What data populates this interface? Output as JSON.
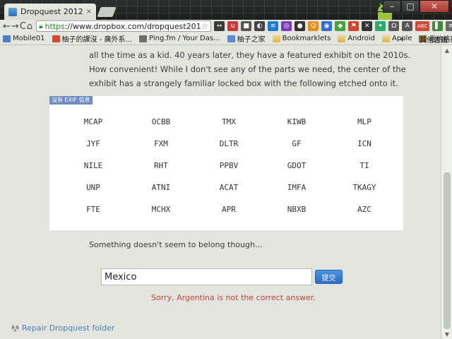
{
  "window": {
    "tab_title": "Dropquest 2012 - Chapte",
    "tab_close": "×",
    "minimize": "–",
    "maximize": "□",
    "close": "✕"
  },
  "toolbar": {
    "back": "←",
    "forward": "→",
    "reload": "C",
    "home": "⌂",
    "url_scheme": "https",
    "url_rest": "://www.dropbox.com/dropquest2012/cl",
    "star": "☆",
    "extensions": [
      {
        "label": "↔",
        "color": "#3a3a3a"
      },
      {
        "label": "u",
        "color": "#c93a3a"
      },
      {
        "label": "■",
        "color": "#555555"
      },
      {
        "label": "◐",
        "color": "#444444"
      },
      {
        "label": "≡",
        "color": "#1e7ad8"
      },
      {
        "label": "◎",
        "color": "#7a3bb8"
      },
      {
        "label": "●",
        "color": "#333333"
      },
      {
        "label": "Q",
        "color": "#e49022"
      },
      {
        "label": "◉",
        "color": "#2f6fd0"
      },
      {
        "label": "◆",
        "color": "#4ca23a"
      },
      {
        "label": "⚑",
        "color": "#d8402f"
      },
      {
        "label": "✕",
        "color": "#333333"
      },
      {
        "label": "✦",
        "color": "#2caa6a"
      },
      {
        "label": "Ω",
        "color": "#5a5a5a"
      },
      {
        "label": "A",
        "color": "#555555"
      },
      {
        "label": "ABC",
        "color": "#d34a3a"
      },
      {
        "label": "▌",
        "color": "#3f8a3f"
      },
      {
        "label": "≡",
        "color": "#666666"
      }
    ]
  },
  "bookmarks": {
    "items": [
      {
        "label": "Mobile01",
        "color": "#4a7fd0"
      },
      {
        "label": "柚子的課沒 - 廣外系...",
        "color": "#d9472f"
      },
      {
        "label": "Ping.fm / Your Das...",
        "color": "#6e6e6e"
      },
      {
        "label": "柚子之家",
        "color": "#5c8bd6"
      },
      {
        "label": "Bookmarklets",
        "folder": true
      },
      {
        "label": "Android",
        "folder": true
      },
      {
        "label": "Apple",
        "folder": true
      },
      {
        "label": "電信格額查詢",
        "color": "#8a6b3a"
      }
    ],
    "overflow": "»",
    "other_label": "其他書籤"
  },
  "content": {
    "paragraph_lines": [
      "all the time as a kid. 40 years later, they have a featured exhibit on the 2010s.",
      "How convenient! While I don't see any of the parts we need, the center of the",
      "exhibit has a strangely familiar locked box with the following etched onto it."
    ],
    "exif_badge": "沒有 EXIF 信息",
    "codes": [
      "MCAP",
      "OCBB",
      "TMX",
      "KIWB",
      "MLP",
      "JYF",
      "FXM",
      "DLTR",
      "GF",
      "ICN",
      "NILE",
      "RHT",
      "PPBV",
      "GDOT",
      "TI",
      "UNP",
      "ATNI",
      "ACAT",
      "IMFA",
      "TKAGY",
      "FTE",
      "MCHX",
      "APR",
      "NBXB",
      "AZC"
    ],
    "hint": "Something doesn't seem to belong though...",
    "answer_value": "Mexico",
    "submit_label": "提交",
    "error": "Sorry, Argentina is not the correct answer.",
    "repair_link": "Repair Dropquest folder"
  }
}
